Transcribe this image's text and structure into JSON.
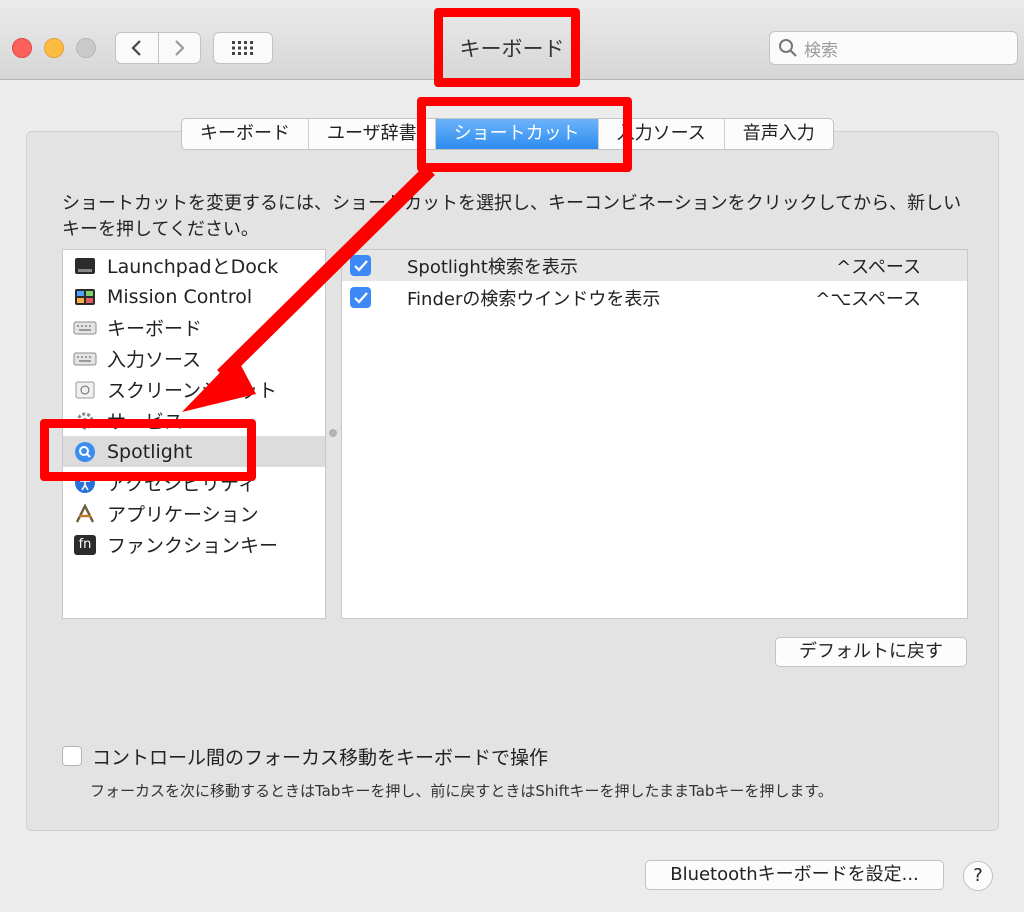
{
  "window": {
    "title": "キーボード",
    "search_placeholder": "検索"
  },
  "tabs": [
    {
      "label": "キーボード"
    },
    {
      "label": "ユーザ辞書"
    },
    {
      "label": "ショートカット"
    },
    {
      "label": "入力ソース"
    },
    {
      "label": "音声入力"
    }
  ],
  "instructions": "ショートカットを変更するには、ショートカットを選択し、キーコンビネーションをクリックしてから、新しいキーを押してください。",
  "categories": [
    {
      "label": "LaunchpadとDock",
      "icon": "launchpad-dock-icon"
    },
    {
      "label": "Mission Control",
      "icon": "mission-control-icon"
    },
    {
      "label": "キーボード",
      "icon": "keyboard-icon"
    },
    {
      "label": "入力ソース",
      "icon": "input-source-icon"
    },
    {
      "label": "スクリーンショット",
      "icon": "screenshot-icon"
    },
    {
      "label": "サービス",
      "icon": "services-gear-icon"
    },
    {
      "label": "Spotlight",
      "icon": "spotlight-icon"
    },
    {
      "label": "アクセシビリティ",
      "icon": "accessibility-icon"
    },
    {
      "label": "アプリケーション",
      "icon": "app-shortcut-icon"
    },
    {
      "label": "ファンクションキー",
      "icon": "fn-key-icon"
    }
  ],
  "fn_glyph": "fn",
  "shortcuts": [
    {
      "label": "Spotlight検索を表示",
      "key": "^スペース",
      "checked": true
    },
    {
      "label": "Finderの検索ウインドウを表示",
      "key": "^⌥スペース",
      "checked": true
    }
  ],
  "buttons": {
    "restore_defaults": "デフォルトに戻す",
    "bluetooth": "Bluetoothキーボードを設定...",
    "help": "?"
  },
  "focus_option": {
    "label": "コントロール間のフォーカス移動をキーボードで操作",
    "note": "フォーカスを次に移動するときはTabキーを押し、前に戻すときはShiftキーを押したままTabキーを押します。"
  },
  "colors": {
    "highlight": "#ff0000",
    "accent": "#2d8cf0"
  }
}
